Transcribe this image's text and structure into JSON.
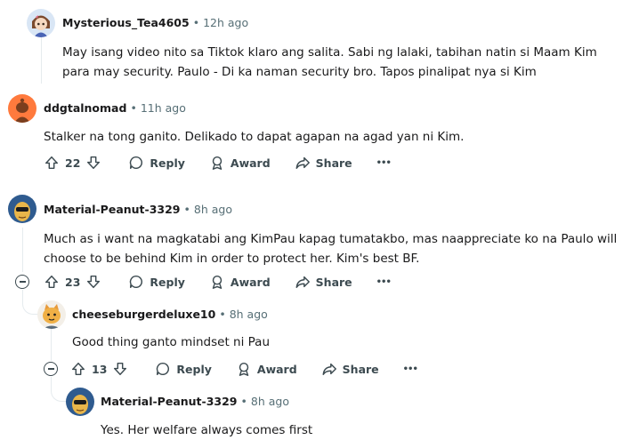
{
  "comments": [
    {
      "author": "Mysterious_Tea4605",
      "time": "12h ago",
      "text": "May isang video nito sa Tiktok klaro ang salita. Sabi ng lalaki, tabihan natin si Maam Kim para may security. Paulo - Di ka naman security bro. Tapos pinalipat nya si Kim"
    },
    {
      "author": "ddgtalnomad",
      "time": "11h ago",
      "text": "Stalker na tong ganito. Delikado to dapat agapan na agad yan ni Kim.",
      "votes": "22"
    },
    {
      "author": "Material-Peanut-3329",
      "time": "8h ago",
      "text": "Much as i want na magkatabi ang KimPau kapag tumatakbo, mas naappreciate ko na Paulo will choose to be behind Kim in order to protect her. Kim's best BF.",
      "votes": "23"
    },
    {
      "author": "cheeseburgerdeluxe10",
      "time": "8h ago",
      "text": "Good thing ganto mindset ni Pau",
      "votes": "13"
    },
    {
      "author": "Material-Peanut-3329",
      "time": "8h ago",
      "text": "Yes. Her welfare always comes first"
    }
  ],
  "actions": {
    "reply": "Reply",
    "award": "Award",
    "share": "Share",
    "more": "•••"
  },
  "icons": {
    "upvote": "upvote-icon",
    "downvote": "downvote-icon",
    "reply": "reply-bubble-icon",
    "award": "award-icon",
    "share": "share-arrow-icon",
    "more": "more-options-icon",
    "collapse": "collapse-minus-icon"
  },
  "colors": {
    "text": "#1a1a1b",
    "meta": "#576f76",
    "thread_line": "#e5ebee",
    "action": "#3c4a50"
  }
}
